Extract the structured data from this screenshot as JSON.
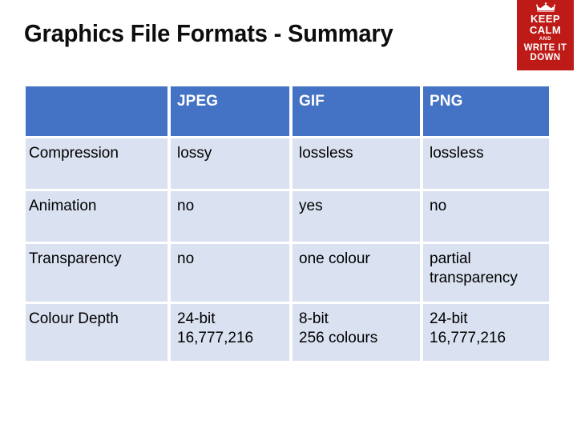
{
  "slide": {
    "title": "Graphics File Formats - Summary",
    "background_color": "#ffffff"
  },
  "poster": {
    "name": "keep-calm-poster",
    "background_color": "#be1b18",
    "text_color": "#ffffff",
    "icon": "crown-icon",
    "line1": "KEEP",
    "line2": "CALM",
    "line3": "AND",
    "line4": "WRITE IT",
    "line5": "DOWN"
  },
  "table": {
    "header_background": "#4472c4",
    "header_text_color": "#ffffff",
    "body_background": "#dae1f0",
    "body_text_color": "#000000",
    "headers": [
      "",
      "JPEG",
      "GIF",
      "PNG"
    ],
    "rows": [
      {
        "label": "Compression",
        "jpeg": "lossy",
        "gif": "lossless",
        "png": "lossless"
      },
      {
        "label": "Animation",
        "jpeg": "no",
        "gif": "yes",
        "png": "no"
      },
      {
        "label": "Transparency",
        "jpeg": "no",
        "gif": "one colour",
        "png_line1": "partial",
        "png_line2": "transparency"
      },
      {
        "label": "Colour Depth",
        "jpeg_line1": "24-bit",
        "jpeg_line2": "16,777,216",
        "gif_line1": "8-bit",
        "gif_line2": "256 colours",
        "png_line1": "24-bit",
        "png_line2": "16,777,216"
      }
    ]
  }
}
